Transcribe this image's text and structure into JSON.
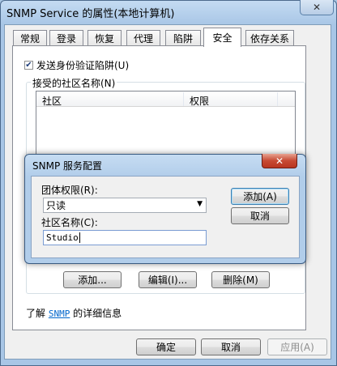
{
  "window": {
    "title": "SNMP Service 的属性(本地计算机)",
    "close_glyph": "✕"
  },
  "tabs": [
    {
      "label": "常规"
    },
    {
      "label": "登录"
    },
    {
      "label": "恢复"
    },
    {
      "label": "代理"
    },
    {
      "label": "陷阱"
    },
    {
      "label": "安全",
      "active": true
    },
    {
      "label": "依存关系"
    }
  ],
  "security": {
    "send_auth_trap": {
      "label": "发送身份验证陷阱(U)",
      "checked": true
    },
    "communities_group": {
      "label": "接受的社区名称(N)",
      "columns": [
        "社区",
        "权限"
      ],
      "rows": []
    },
    "buttons": {
      "add": "添加...",
      "edit": "编辑(I)...",
      "remove": "删除(M)"
    },
    "learn_more": {
      "prefix": "了解",
      "link": "SNMP",
      "suffix": "的详细信息"
    }
  },
  "footer_buttons": {
    "ok": "确定",
    "cancel": "取消",
    "apply": "应用(A)"
  },
  "dialog": {
    "title": "SNMP 服务配置",
    "close_glyph": "✕",
    "rights_label": "团体权限(R):",
    "rights_value": "只读",
    "name_label": "社区名称(C):",
    "name_value": "Studio",
    "add_button": "添加(A)",
    "cancel_button": "取消"
  },
  "colors": {
    "checkmark": "#1f3d7a",
    "link": "#0066cc",
    "dialog_close": "#c74a33"
  }
}
